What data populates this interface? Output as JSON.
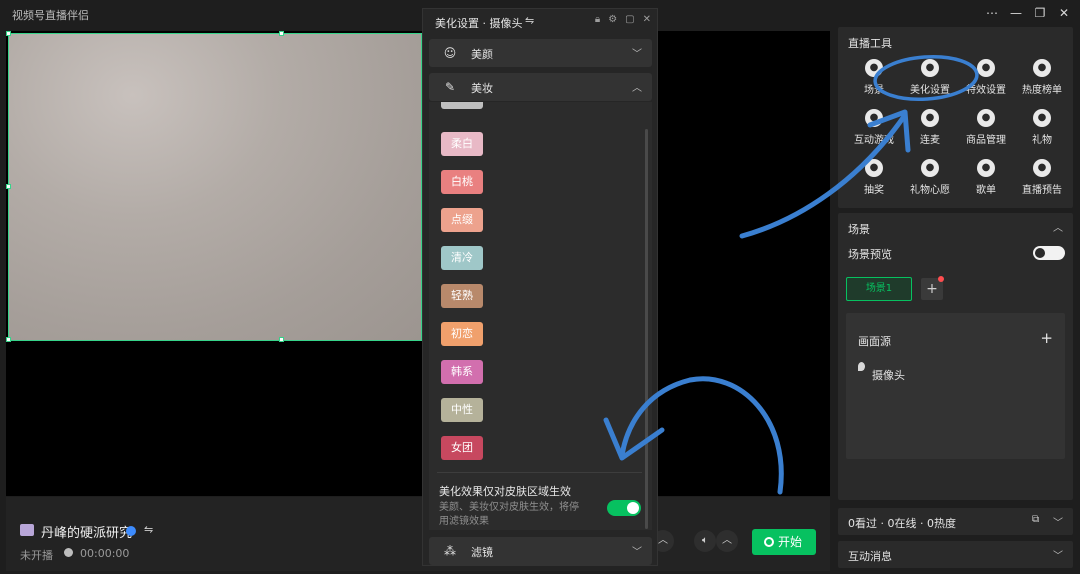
{
  "app": {
    "title": "视频号直播伴侣",
    "window_controls": [
      "⋯",
      "—",
      "❐",
      "✕"
    ]
  },
  "beauty_panel": {
    "title": "美化设置 · 摄像头",
    "switch_icon": "⇋",
    "header_icons": [
      "lock-icon",
      "settings-icon",
      "restore-icon",
      "close-icon"
    ],
    "sections": {
      "beauty": "美颜",
      "makeup": "美妆",
      "filter": "滤镜"
    },
    "makeup_styles": [
      {
        "label": "柔白",
        "color": "#e8b9c6"
      },
      {
        "label": "白桃",
        "color": "#e98080"
      },
      {
        "label": "点缀",
        "color": "#eda28d"
      },
      {
        "label": "清冷",
        "color": "#9fc7c8"
      },
      {
        "label": "轻熟",
        "color": "#b8896b"
      },
      {
        "label": "初恋",
        "color": "#f0a06c"
      },
      {
        "label": "韩系",
        "color": "#d26fae"
      },
      {
        "label": "中性",
        "color": "#b5b29a"
      },
      {
        "label": "女团",
        "color": "#c7485f"
      }
    ],
    "skin_only": {
      "title": "美化效果仅对皮肤区域生效",
      "desc": "美颜、美妆仅对皮肤生效，将停用滤镜效果",
      "enabled": true
    }
  },
  "bottom": {
    "channel_name": "丹峰的硬派研究",
    "status": "未开播",
    "timer": "00:00:00",
    "start_label": "开始"
  },
  "right": {
    "tools_title": "直播工具",
    "tools": [
      {
        "label": "场景",
        "icon": "scene-icon"
      },
      {
        "label": "美化设置",
        "icon": "beauty-settings-icon"
      },
      {
        "label": "特效设置",
        "icon": "effects-icon"
      },
      {
        "label": "热度榜单",
        "icon": "hot-list-icon"
      },
      {
        "label": "互动游戏",
        "icon": "game-icon"
      },
      {
        "label": "连麦",
        "icon": "co-host-icon"
      },
      {
        "label": "商品管理",
        "icon": "product-icon"
      },
      {
        "label": "礼物",
        "icon": "gift-icon"
      },
      {
        "label": "抽奖",
        "icon": "lottery-icon"
      },
      {
        "label": "礼物心愿",
        "icon": "gift-wish-icon"
      },
      {
        "label": "歌单",
        "icon": "playlist-icon"
      },
      {
        "label": "直播预告",
        "icon": "preview-icon"
      }
    ],
    "scene_title": "场景",
    "scene_preview": "场景预览",
    "scene_preview_on": false,
    "scene_chip": "场景1",
    "source_title": "画面源",
    "source_item": "摄像头",
    "stats": "0看过 · 0在线 · 0热度",
    "messages": "互动消息"
  },
  "accent": {
    "green": "#07c160",
    "annotation_blue": "#3a7fd0"
  }
}
